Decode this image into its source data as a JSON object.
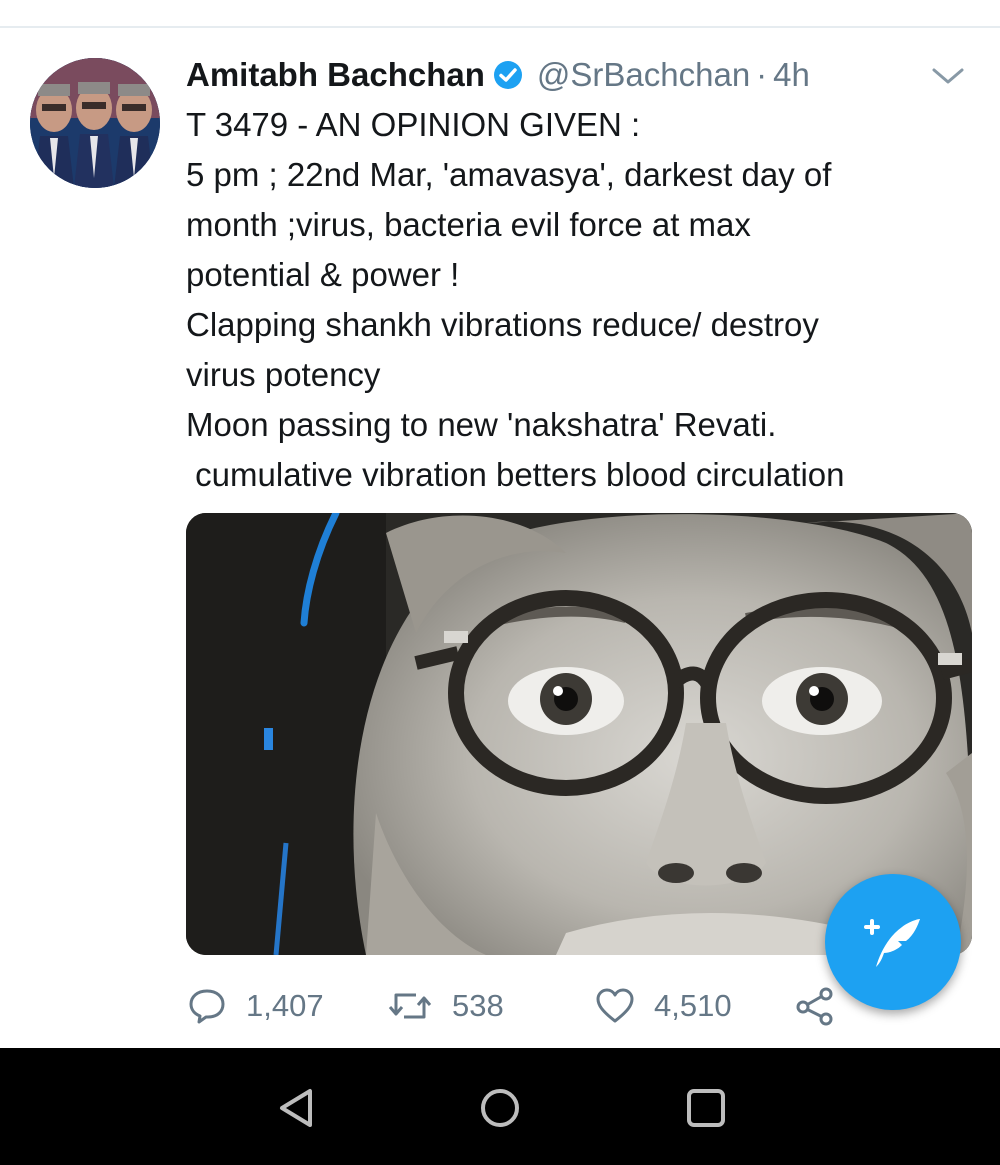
{
  "tweet": {
    "display_name": "Amitabh Bachchan",
    "handle": "@SrBachchan",
    "separator": "·",
    "time": "4h",
    "verified": true,
    "lines": [
      "T 3479 - AN OPINION GIVEN :",
      "5 pm ; 22nd Mar, 'amavasya', darkest day of",
      "month ;virus, bacteria evil force at max",
      "potential & power !",
      "Clapping shankh vibrations reduce/ destroy",
      "virus potency",
      "Moon passing to new 'nakshatra' Revati.",
      " cumulative vibration betters blood circulation"
    ]
  },
  "actions": {
    "reply_count": "1,407",
    "retweet_count": "538",
    "like_count": "4,510"
  },
  "icons": {
    "verified": "verified-badge-icon",
    "more": "chevron-down-icon",
    "reply": "reply-icon",
    "retweet": "retweet-icon",
    "like": "heart-icon",
    "share": "share-icon",
    "compose": "compose-tweet-icon",
    "nav_back": "back-triangle-icon",
    "nav_home": "home-circle-icon",
    "nav_recents": "recents-square-icon"
  },
  "colors": {
    "accent": "#1da1f2",
    "text_primary": "#14171a",
    "text_secondary": "#657786",
    "navbar": "#000000"
  }
}
